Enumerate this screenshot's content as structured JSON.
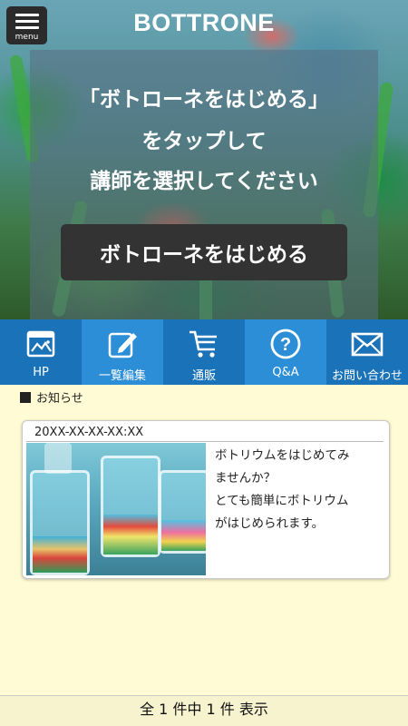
{
  "header": {
    "menu_label": "menu",
    "brand": "BOTTRONE"
  },
  "hero": {
    "instruction_lines": [
      "「ボトローネをはじめる」",
      "をタップして",
      "講師を選択してください"
    ],
    "start_button": "ボトローネをはじめる"
  },
  "nav": {
    "items": [
      {
        "label": "HP",
        "icon": "homepage-icon"
      },
      {
        "label": "一覧編集",
        "icon": "edit-icon"
      },
      {
        "label": "通販",
        "icon": "cart-icon"
      },
      {
        "label": "Q&A",
        "icon": "question-icon"
      },
      {
        "label": "お問い合わせ",
        "icon": "mail-icon"
      }
    ],
    "colors": {
      "dark": "#1a73b8",
      "light": "#2b8ed6"
    }
  },
  "notice": {
    "heading": "お知らせ",
    "posts": [
      {
        "date": "20XX-XX-XX-XX:XX",
        "text_lines": [
          "ボトリウムをはじめてみ",
          "ませんか？",
          "とても簡単にボトリウム",
          "がはじめられます。"
        ]
      }
    ]
  },
  "footer": {
    "count_text": "全 1 件中 1 件 表示"
  }
}
